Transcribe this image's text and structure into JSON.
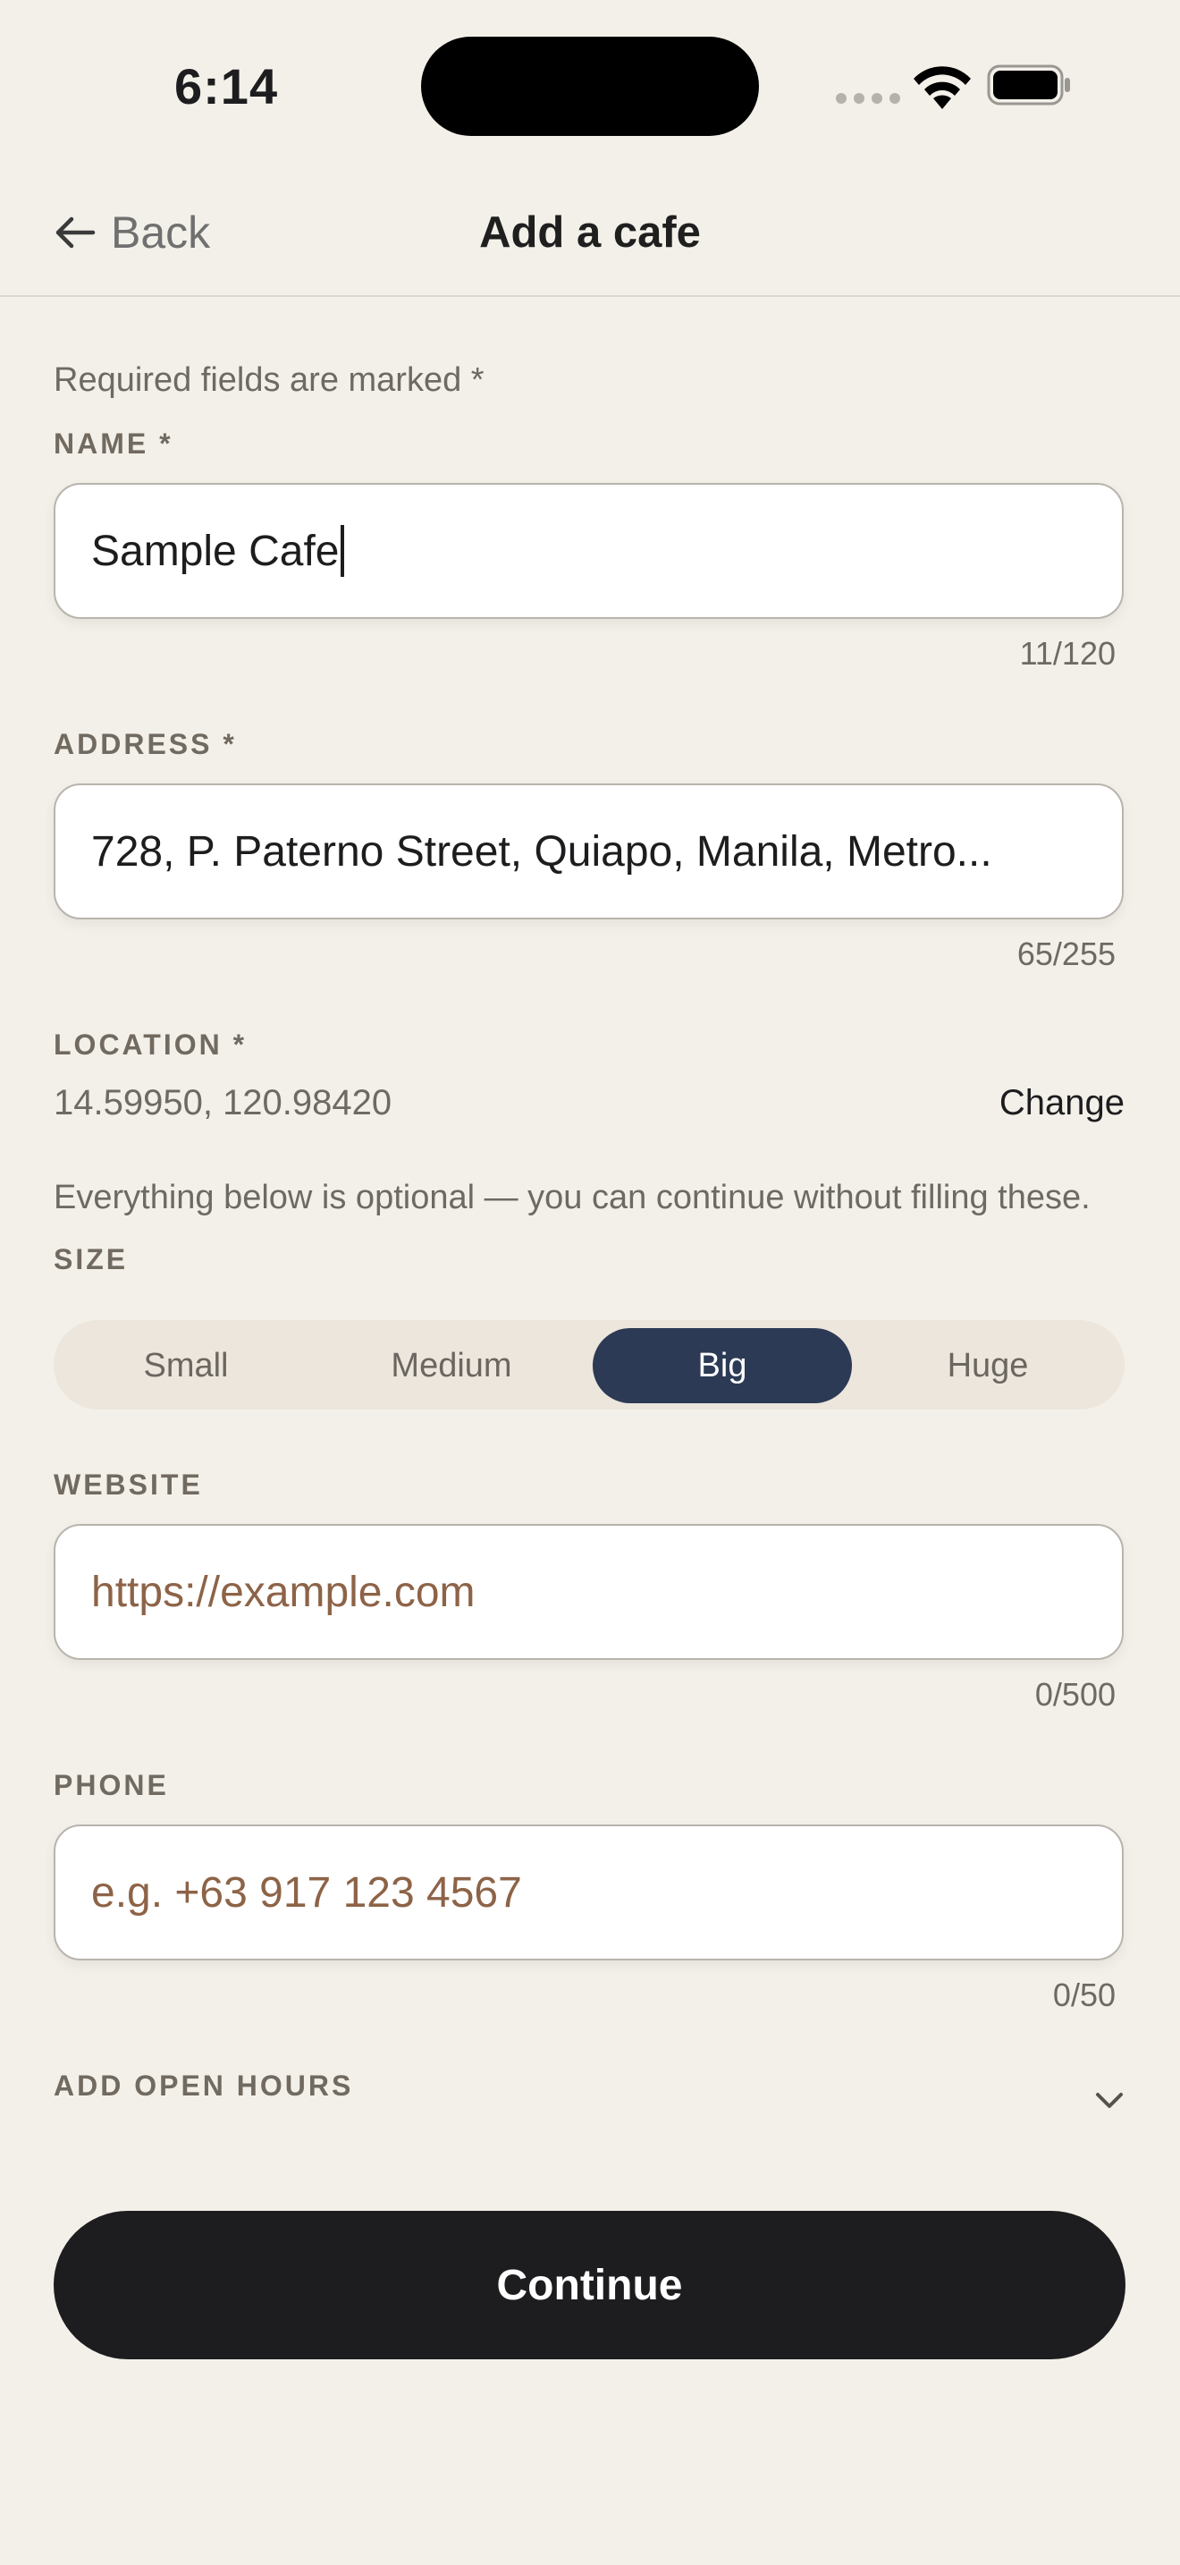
{
  "status_bar": {
    "time": "6:14"
  },
  "nav": {
    "back_label": "Back",
    "title": "Add a cafe"
  },
  "form": {
    "required_note": "Required fields are marked *",
    "name": {
      "label": "NAME *",
      "value": "Sample Cafe",
      "counter": "11/120"
    },
    "address": {
      "label": "ADDRESS *",
      "value": "728, P. Paterno Street, Quiapo, Manila, Metro...",
      "counter": "65/255"
    },
    "location": {
      "label": "LOCATION *",
      "value": "14.59950, 120.98420",
      "change_label": "Change"
    },
    "optional_note": "Everything below is optional — you can continue without filling these.",
    "size": {
      "label": "SIZE",
      "options": [
        "Small",
        "Medium",
        "Big",
        "Huge"
      ],
      "selected": "Big"
    },
    "website": {
      "label": "WEBSITE",
      "placeholder": "https://example.com",
      "counter": "0/500"
    },
    "phone": {
      "label": "PHONE",
      "placeholder": "e.g. +63 917 123 4567",
      "counter": "0/50"
    },
    "open_hours": {
      "label": "ADD OPEN HOURS",
      "icon": "chevron-down-icon"
    }
  },
  "continue_label": "Continue",
  "colors": {
    "background": "#f3f0e9",
    "selected_segment": "#2d3a55",
    "placeholder": "#8d6347",
    "primary_button": "#1d1d1f"
  }
}
